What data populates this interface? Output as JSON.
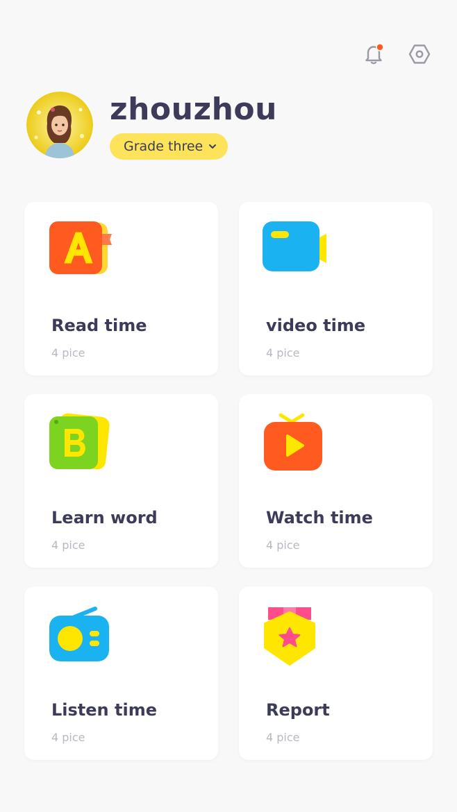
{
  "header": {
    "has_notification": true
  },
  "profile": {
    "username": "zhouzhou",
    "grade": "Grade three"
  },
  "colors": {
    "accent_yellow": "#fde35a",
    "text_dark": "#3c3c5a",
    "text_muted": "#b8b8c2",
    "notification_dot": "#ff5a1f"
  },
  "cards": [
    {
      "title": "Read time",
      "subtitle": "4 pice",
      "icon": "book-a-icon"
    },
    {
      "title": "video time",
      "subtitle": "4 pice",
      "icon": "video-camera-icon"
    },
    {
      "title": "Learn word",
      "subtitle": "4 pice",
      "icon": "letter-b-icon"
    },
    {
      "title": "Watch time",
      "subtitle": "4 pice",
      "icon": "tv-play-icon"
    },
    {
      "title": "Listen time",
      "subtitle": "4 pice",
      "icon": "radio-icon"
    },
    {
      "title": "Report",
      "subtitle": "4 pice",
      "icon": "medal-star-icon"
    }
  ]
}
